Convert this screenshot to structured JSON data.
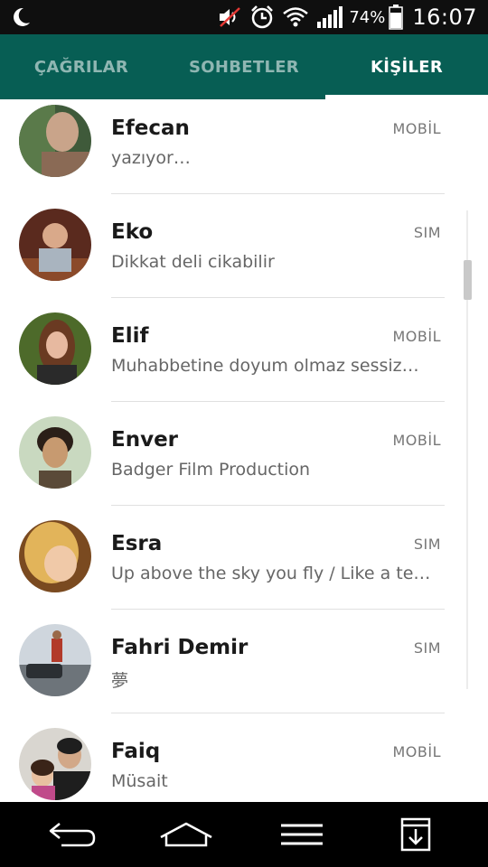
{
  "status_bar": {
    "battery_percent": "74%",
    "time": "16:07",
    "icons": [
      "moon-icon",
      "mute-icon",
      "alarm-icon",
      "wifi-icon",
      "signal-icon",
      "battery-icon"
    ]
  },
  "tabs": [
    {
      "label": "ÇAĞRILAR",
      "active": false
    },
    {
      "label": "SOHBETLER",
      "active": false
    },
    {
      "label": "KİŞİLER",
      "active": true
    }
  ],
  "colors": {
    "primary": "#075e54",
    "status_bar": "#0f0f0f",
    "nav_bar": "#000000",
    "divider": "#e0e0e0"
  },
  "contacts": [
    {
      "name": "Efecan",
      "status": "yazıyor…",
      "type": "MOBİL"
    },
    {
      "name": "Eko",
      "status": "Dikkat deli cikabilir",
      "type": "SIM"
    },
    {
      "name": "Elif",
      "status": "Muhabbetine doyum olmaz sessiz…",
      "type": "MOBİL"
    },
    {
      "name": "Enver",
      "status": "Badger Film Production",
      "type": "MOBİL"
    },
    {
      "name": "Esra",
      "status": "Up above the sky you fly / Like a te…",
      "type": "SIM"
    },
    {
      "name": "Fahri Demir",
      "status": "夢",
      "type": "SIM"
    },
    {
      "name": "Faiq",
      "status": "Müsait",
      "type": "MOBİL"
    }
  ],
  "nav_bar": {
    "icons": [
      "back-icon",
      "home-icon",
      "menu-icon",
      "download-icon"
    ]
  }
}
